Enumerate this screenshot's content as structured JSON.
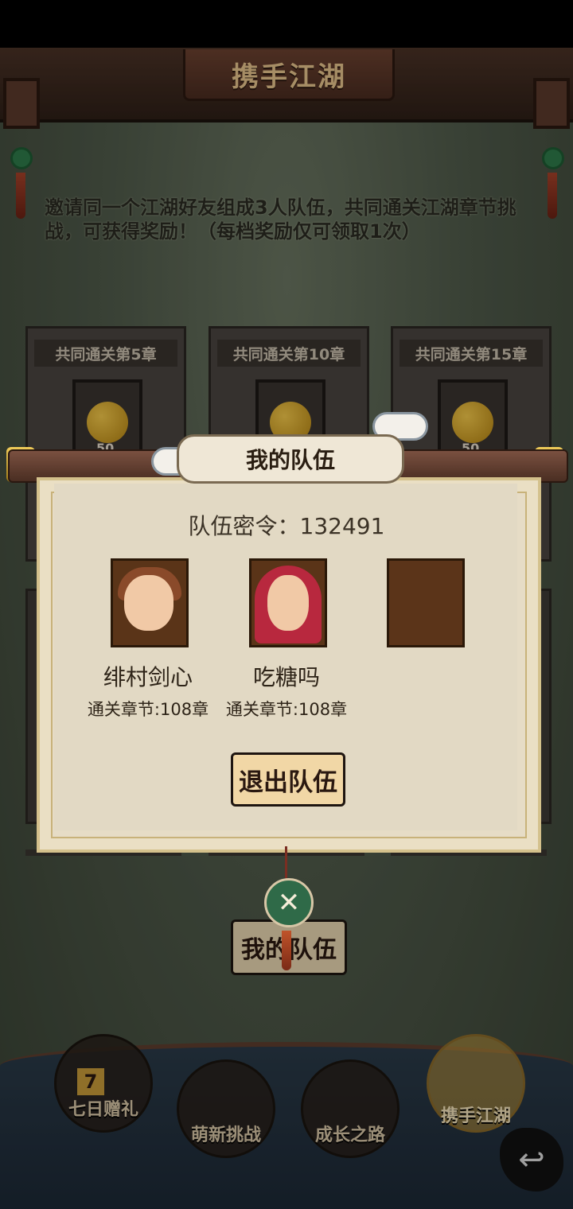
{
  "screen_title": "携手江湖",
  "description": "邀请同一个江湖好友组成3人队伍，共同通关江湖章节挑战，可获得奖励！（每档奖励仅可领取1次）",
  "reward_cards": [
    {
      "label": "共同通关第5章",
      "quantity": "50",
      "icon": "gourd-icon"
    },
    {
      "label": "共同通关第10章",
      "quantity": "",
      "icon": "gourd-icon"
    },
    {
      "label": "共同通关第15章",
      "quantity": "50",
      "icon": "gourd-icon"
    }
  ],
  "modal": {
    "title": "我的队伍",
    "team_code_label": "队伍密令：132491",
    "members": [
      {
        "name": "绯村剑心",
        "stage": "通关章节:108章"
      },
      {
        "name": "吃糖吗",
        "stage": "通关章节:108章"
      }
    ],
    "leave_button": "退出队伍",
    "close_icon": "close-icon"
  },
  "background_button": "我的队伍",
  "nav": [
    {
      "label": "七日赠礼",
      "badge": "7"
    },
    {
      "label": "萌新挑战"
    },
    {
      "label": "成长之路"
    },
    {
      "label": "携手江湖",
      "active": true
    }
  ],
  "back_icon": "back-arrow-icon",
  "colors": {
    "accent_gold": "#c69a3a",
    "modal_bg": "#e2d9c4",
    "button_bg": "#f1d7a6",
    "jade": "#2f6a48"
  }
}
